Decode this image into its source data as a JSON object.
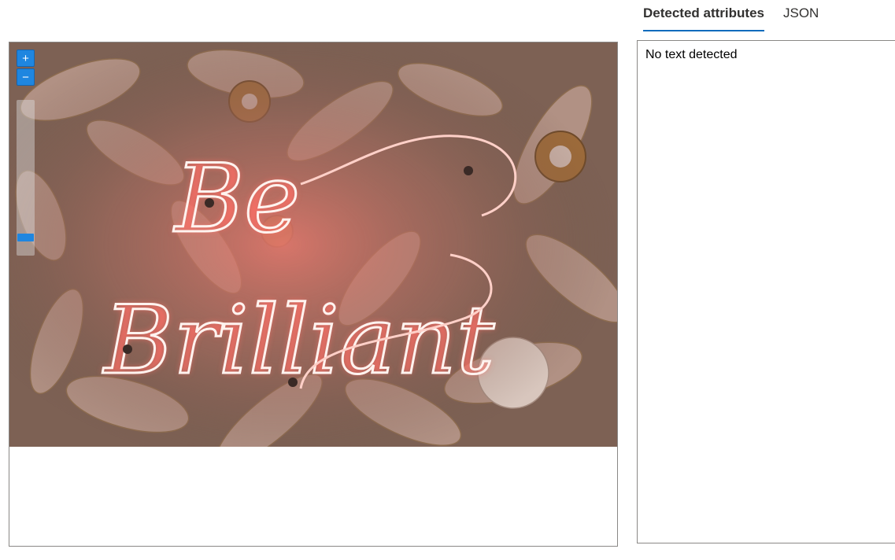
{
  "tabs": [
    {
      "label": "Detected attributes",
      "active": true
    },
    {
      "label": "JSON",
      "active": false
    }
  ],
  "viewer": {
    "zoom_in_label": "+",
    "zoom_out_label": "−",
    "image_content": "Be Brilliant",
    "colors": {
      "neon": "#ff8a80",
      "neon_core": "#fff4f0",
      "flowers": "#c9aaa0",
      "background": "#7a5a4d"
    }
  },
  "results": {
    "message": "No text detected"
  }
}
